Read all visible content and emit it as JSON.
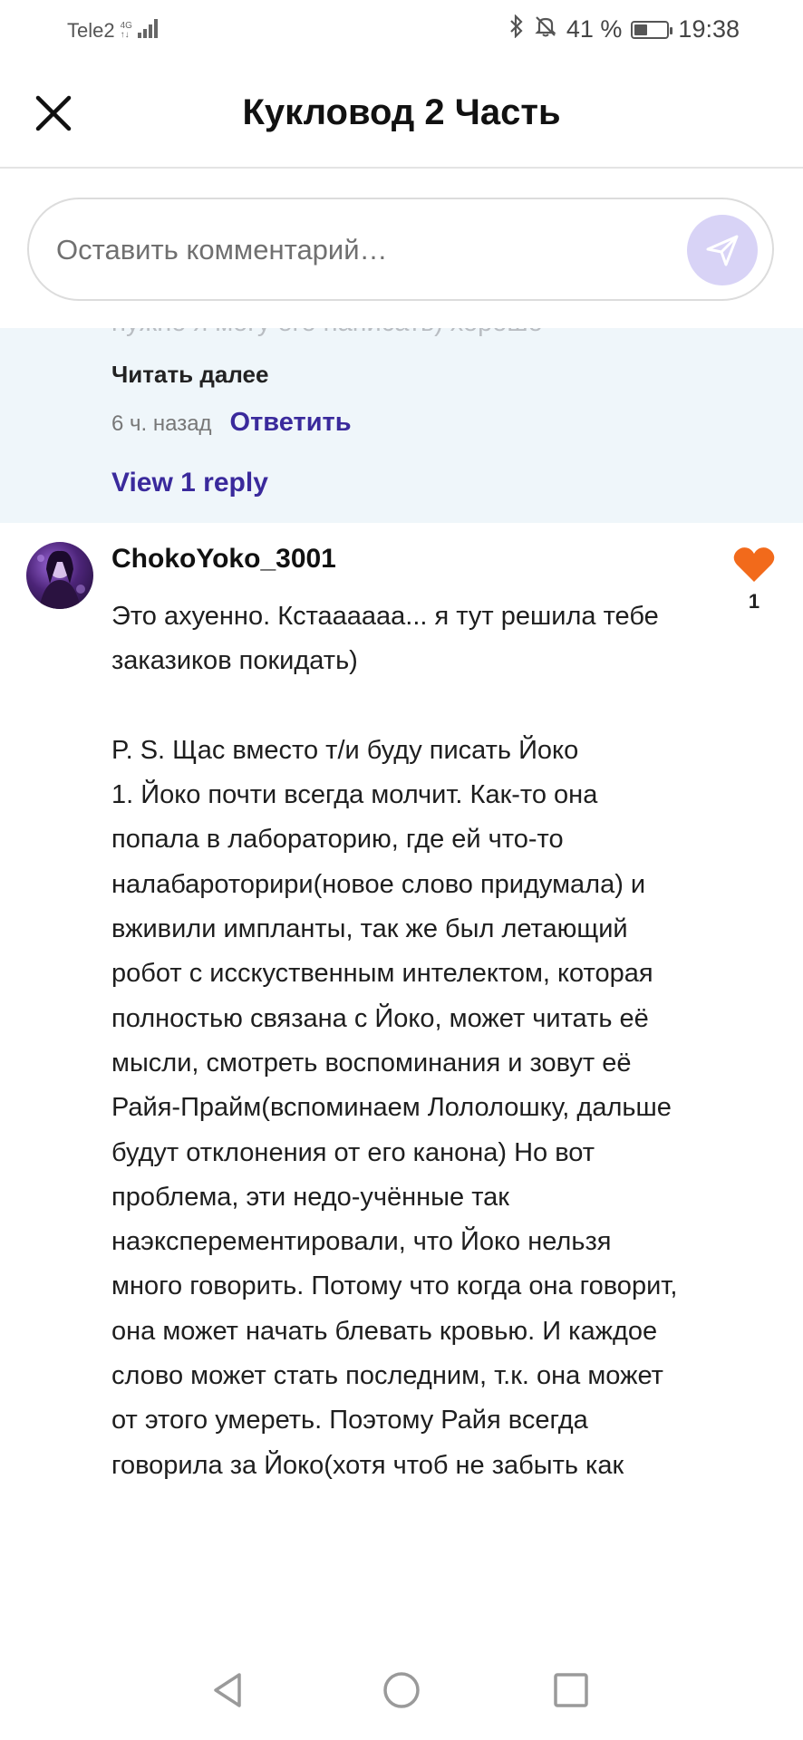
{
  "status_bar": {
    "carrier": "Tele2",
    "network_top": "4G",
    "network_bottom": "↑↓",
    "battery_percent": "41 %",
    "battery_level": 0.41,
    "time": "19:38",
    "icons": [
      "signal-icon",
      "bluetooth-icon",
      "bell-off-icon",
      "battery-icon"
    ]
  },
  "header": {
    "title": "Кукловод 2 Часть",
    "close_icon": "close-icon"
  },
  "composer": {
    "placeholder": "Оставить комментарий…",
    "send_icon": "send-icon",
    "send_color": "#d8d3f6"
  },
  "previous_comment": {
    "truncated_text": "нужно я могу его написать) хорошо",
    "read_more": "Читать далее",
    "time": "6 ч. назад",
    "reply": "Ответить",
    "view_replies": "View 1 reply",
    "background": "#eff6fa"
  },
  "comment": {
    "username": "ChokoYoko_3001",
    "likes": "1",
    "like_icon": "heart-icon",
    "like_color": "#f26a1b",
    "body_paragraph_1": "Это ахуенно. Кстаааааа... я тут решила тебе заказиков покидать)",
    "body_paragraph_2": "P. S. Щас вместо т/и буду писать Йоко",
    "body_paragraph_3": "1. Йоко почти всегда молчит. Как-то она попала в лабораторию, где ей что-то налабароторири(новое слово придумала) и вживили импланты, так же был летающий робот с исскуственным интелектом, которая полностью связана с Йоко, может читать её мысли, смотреть воспоминания и зовут её Райя-Прайм(вспоминаем Лололошку, дальше будут отклонения от его канона) Но вот проблема, эти недо-учённые так наэксперементировали, что Йоко нельзя много говорить. Потому что когда она говорит, она может начать блевать кровью. И каждое слово может стать последним, т.к. она может от этого умереть. Поэтому Райя всегда говорила за Йоко(хотя чтоб не забыть как"
  },
  "nav_bar": {
    "buttons": [
      "back-icon",
      "home-icon",
      "recents-icon"
    ]
  },
  "colors": {
    "accent": "#3a2a9c",
    "divider": "#e4e4e4"
  }
}
